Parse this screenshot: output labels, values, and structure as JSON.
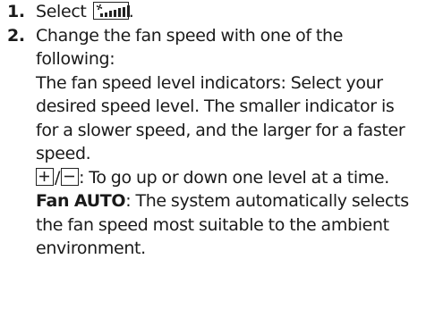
{
  "steps": [
    {
      "number": "1.",
      "text_before": "Select ",
      "icon": "fan-speed-icon",
      "text_after": "."
    },
    {
      "number": "2.",
      "intro": "Change the fan speed with one of the following:",
      "items": [
        {
          "term": "",
          "text": "The fan speed level indicators: Select your desired speed level. The smaller indicator is for a slower speed, and the larger for a faster speed."
        },
        {
          "keys": [
            "plus-key-icon",
            "minus-key-icon"
          ],
          "key_separator": "/",
          "text": ": To go up or down one level at a time."
        },
        {
          "term": "Fan AUTO",
          "text": ": The system automatically selects the fan speed most suitable to the ambient environment."
        }
      ]
    }
  ]
}
